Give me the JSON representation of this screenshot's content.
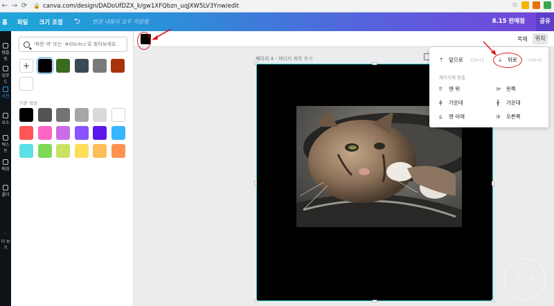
{
  "browser": {
    "url": "canva.com/design/DADoUfDZX_k/gw1XFQbzn_uqJXW5LV3Ynw/edit",
    "back_icon": "arrow-left-icon",
    "forward_icon": "arrow-right-icon",
    "reload_icon": "reload-icon",
    "lock_icon": "lock-icon",
    "star_icon": "star-icon",
    "extensions": [
      "#f4b400",
      "#e8710a",
      "#34a853"
    ]
  },
  "topbar": {
    "home": "홈",
    "file": "파일",
    "resize": "크기 조정",
    "undo_icon": "undo-icon",
    "saved": "변경 내용이 모두 저장됨",
    "price": "8.15 판매점",
    "share": "공유"
  },
  "iconbar": {
    "items": [
      {
        "label": "템플릿",
        "icon": "template-icon"
      },
      {
        "label": "업로드",
        "icon": "upload-icon"
      },
      {
        "label": "사진",
        "icon": "photo-icon"
      },
      {
        "label": "요소",
        "icon": "elements-icon"
      },
      {
        "label": "텍스트",
        "icon": "text-icon"
      },
      {
        "label": "배경",
        "icon": "background-icon"
      },
      {
        "label": "폴더",
        "icon": "folder-icon"
      },
      {
        "label": "더 보기",
        "icon": "more-icon"
      }
    ]
  },
  "colors": {
    "search_placeholder": "'파란 색' 또는 '#00c4cc'로 찾아보세요.",
    "document_colors": [
      "#000000",
      "#3a6a1f",
      "#3a4a55",
      "#7a7a7a",
      "#a8330a"
    ],
    "default_label": "기본 색상",
    "default_colors": [
      "#000000",
      "#545454",
      "#737373",
      "#a6a6a6",
      "#d9d9d9",
      "#ffffff",
      "#ff5757",
      "#ff66c4",
      "#cb6ce6",
      "#8c52ff",
      "#5e17eb",
      "#38b6ff",
      "#5ce1e6",
      "#7ed957",
      "#c9e265",
      "#ffde59",
      "#ffbd59",
      "#ff914d"
    ]
  },
  "toolbar": {
    "selected_color": "#000000",
    "duplicate": "복제",
    "position": "위치",
    "more_icon": "more-vertical-icon"
  },
  "page": {
    "label_num": "페이지 4",
    "label_title": " - 페이지 제목 추가"
  },
  "position_menu": {
    "forward": "앞으로",
    "forward_short": "Ctrl+]",
    "backward": "뒤로",
    "backward_short": "Ctrl+[",
    "section": "페이지에 맞춤",
    "top": "맨 위",
    "left": "왼쪽",
    "middle": "가운데",
    "center": "가운데",
    "bottom": "맨 아래",
    "right": "오른쪽"
  },
  "accent": {
    "selection": "#2ccfd4",
    "annotation_red": "#e0161c"
  }
}
